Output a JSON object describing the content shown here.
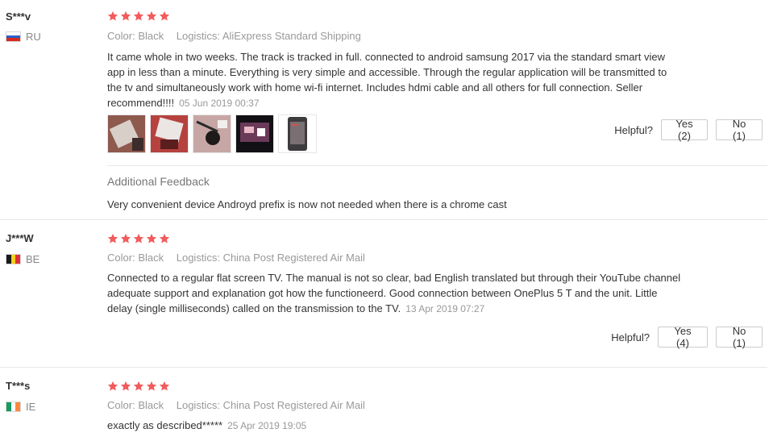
{
  "colors": {
    "star": "#f25b5b",
    "muted": "#999999",
    "text": "#333333",
    "border": "#cccccc"
  },
  "helpful_label": "Helpful?",
  "labels": {
    "color": "Color:",
    "logistics": "Logistics:"
  },
  "reviews": [
    {
      "user": "S***v",
      "country": "RU",
      "rating": 5,
      "color": "Black",
      "logistics": "AliExpress Standard Shipping",
      "text": "It came whole in two weeks. The track is tracked in full. connected to android samsung 2017 via the standard smart view app in less than a minute. Everything is very simple and accessible. Through the regular application will be transmitted to the tv and simultaneously work with home wi-fi internet. Includes hdmi cable and all others for full connection. Seller recommend!!!!",
      "date": "05 Jun 2019 00:37",
      "photos": [
        "photo-1",
        "photo-2",
        "photo-3",
        "photo-4",
        "photo-5"
      ],
      "yes": "Yes (2)",
      "no": "No (1)",
      "additional_title": "Additional Feedback",
      "additional_text": "Very convenient device Androyd prefix is now not needed when there is a chrome cast"
    },
    {
      "user": "J***W",
      "country": "BE",
      "rating": 5,
      "color": "Black",
      "logistics": "China Post Registered Air Mail",
      "text": "Connected to a regular flat screen TV. The manual is not so clear, bad English translated but through their YouTube channel adequate support and explanation got how the functioneerd. Good connection between OnePlus 5 T and the unit. Little delay (single milliseconds) called on the transmission to the TV.",
      "date": "13 Apr 2019 07:27",
      "yes": "Yes (4)",
      "no": "No (1)"
    },
    {
      "user": "T***s",
      "country": "IE",
      "rating": 5,
      "color": "Black",
      "logistics": "China Post Registered Air Mail",
      "text": "exactly as described*****",
      "date": "25 Apr 2019 19:05"
    }
  ]
}
